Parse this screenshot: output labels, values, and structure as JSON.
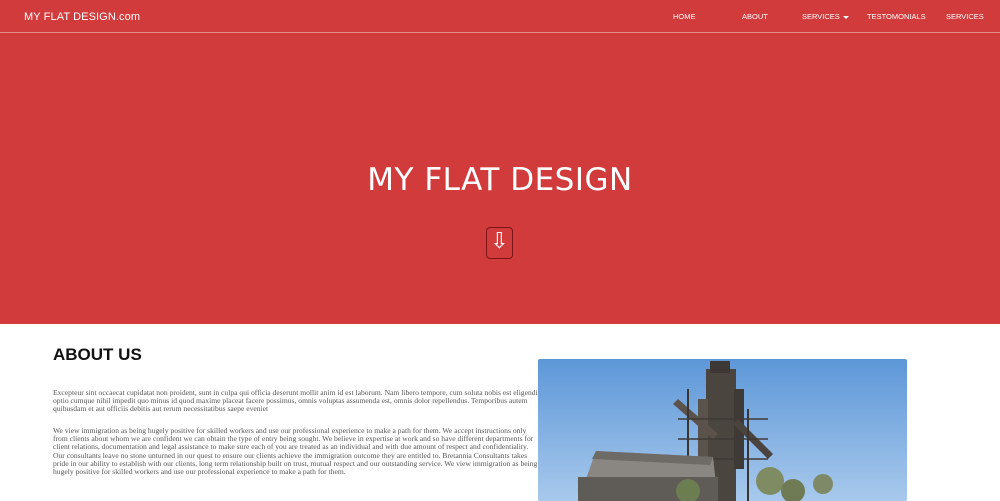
{
  "brand": "MY FLAT DESIGN.com",
  "nav": {
    "home": "HOME",
    "about": "ABOUT",
    "services": "SERVICES",
    "testimonials": "TESTOMONIALS",
    "services_2": "SERVICES"
  },
  "hero": {
    "title": "MY FLAT DESIGN",
    "scroll_icon": "⇩"
  },
  "about": {
    "heading": "ABOUT US",
    "paragraph_1": "Excepteur sint occaecat cupidatat non proident, sunt in culpa qui officia deserunt mollit anim id est laborum. Nam libero tempore, cum soluta nobis est eligendi optio cumque nihil impedit quo minus id quod maxime placeat facere possimus, omnis voluptas assumenda est, omnis dolor repellendus. Temporibus autem quibusdam et aut officiis debitis aut rerum necessitatibus saepe eveniet",
    "paragraph_2": "We view immigration as being hugely positive for skilled workers and use our professional experience to make a path for them. We accept instructions only from clients about whom we are confident we can obtain the type of entry being sought. We believe in expertise at work and so have different departments for client relations, documentation and legal assistance to make sure each of you are treated as an individual and with due amount of respect and confidentiality. Our consultants leave no stone unturned in our quest to ensure our clients achieve the immigration outcome they are entitled to. Bretannia Consultants takes pride in our ability to establish with our clients, long term relationship built on trust, mutual respect and our outstanding service. We view immigration as being hugely positive for skilled workers and use our professional experience to make a path for them."
  },
  "colors": {
    "primary": "#d23b3c",
    "text_dark": "#111111",
    "text_body": "#555555"
  },
  "icons": {
    "scroll_down": "arrow-down-icon",
    "dropdown": "caret-down-icon"
  }
}
